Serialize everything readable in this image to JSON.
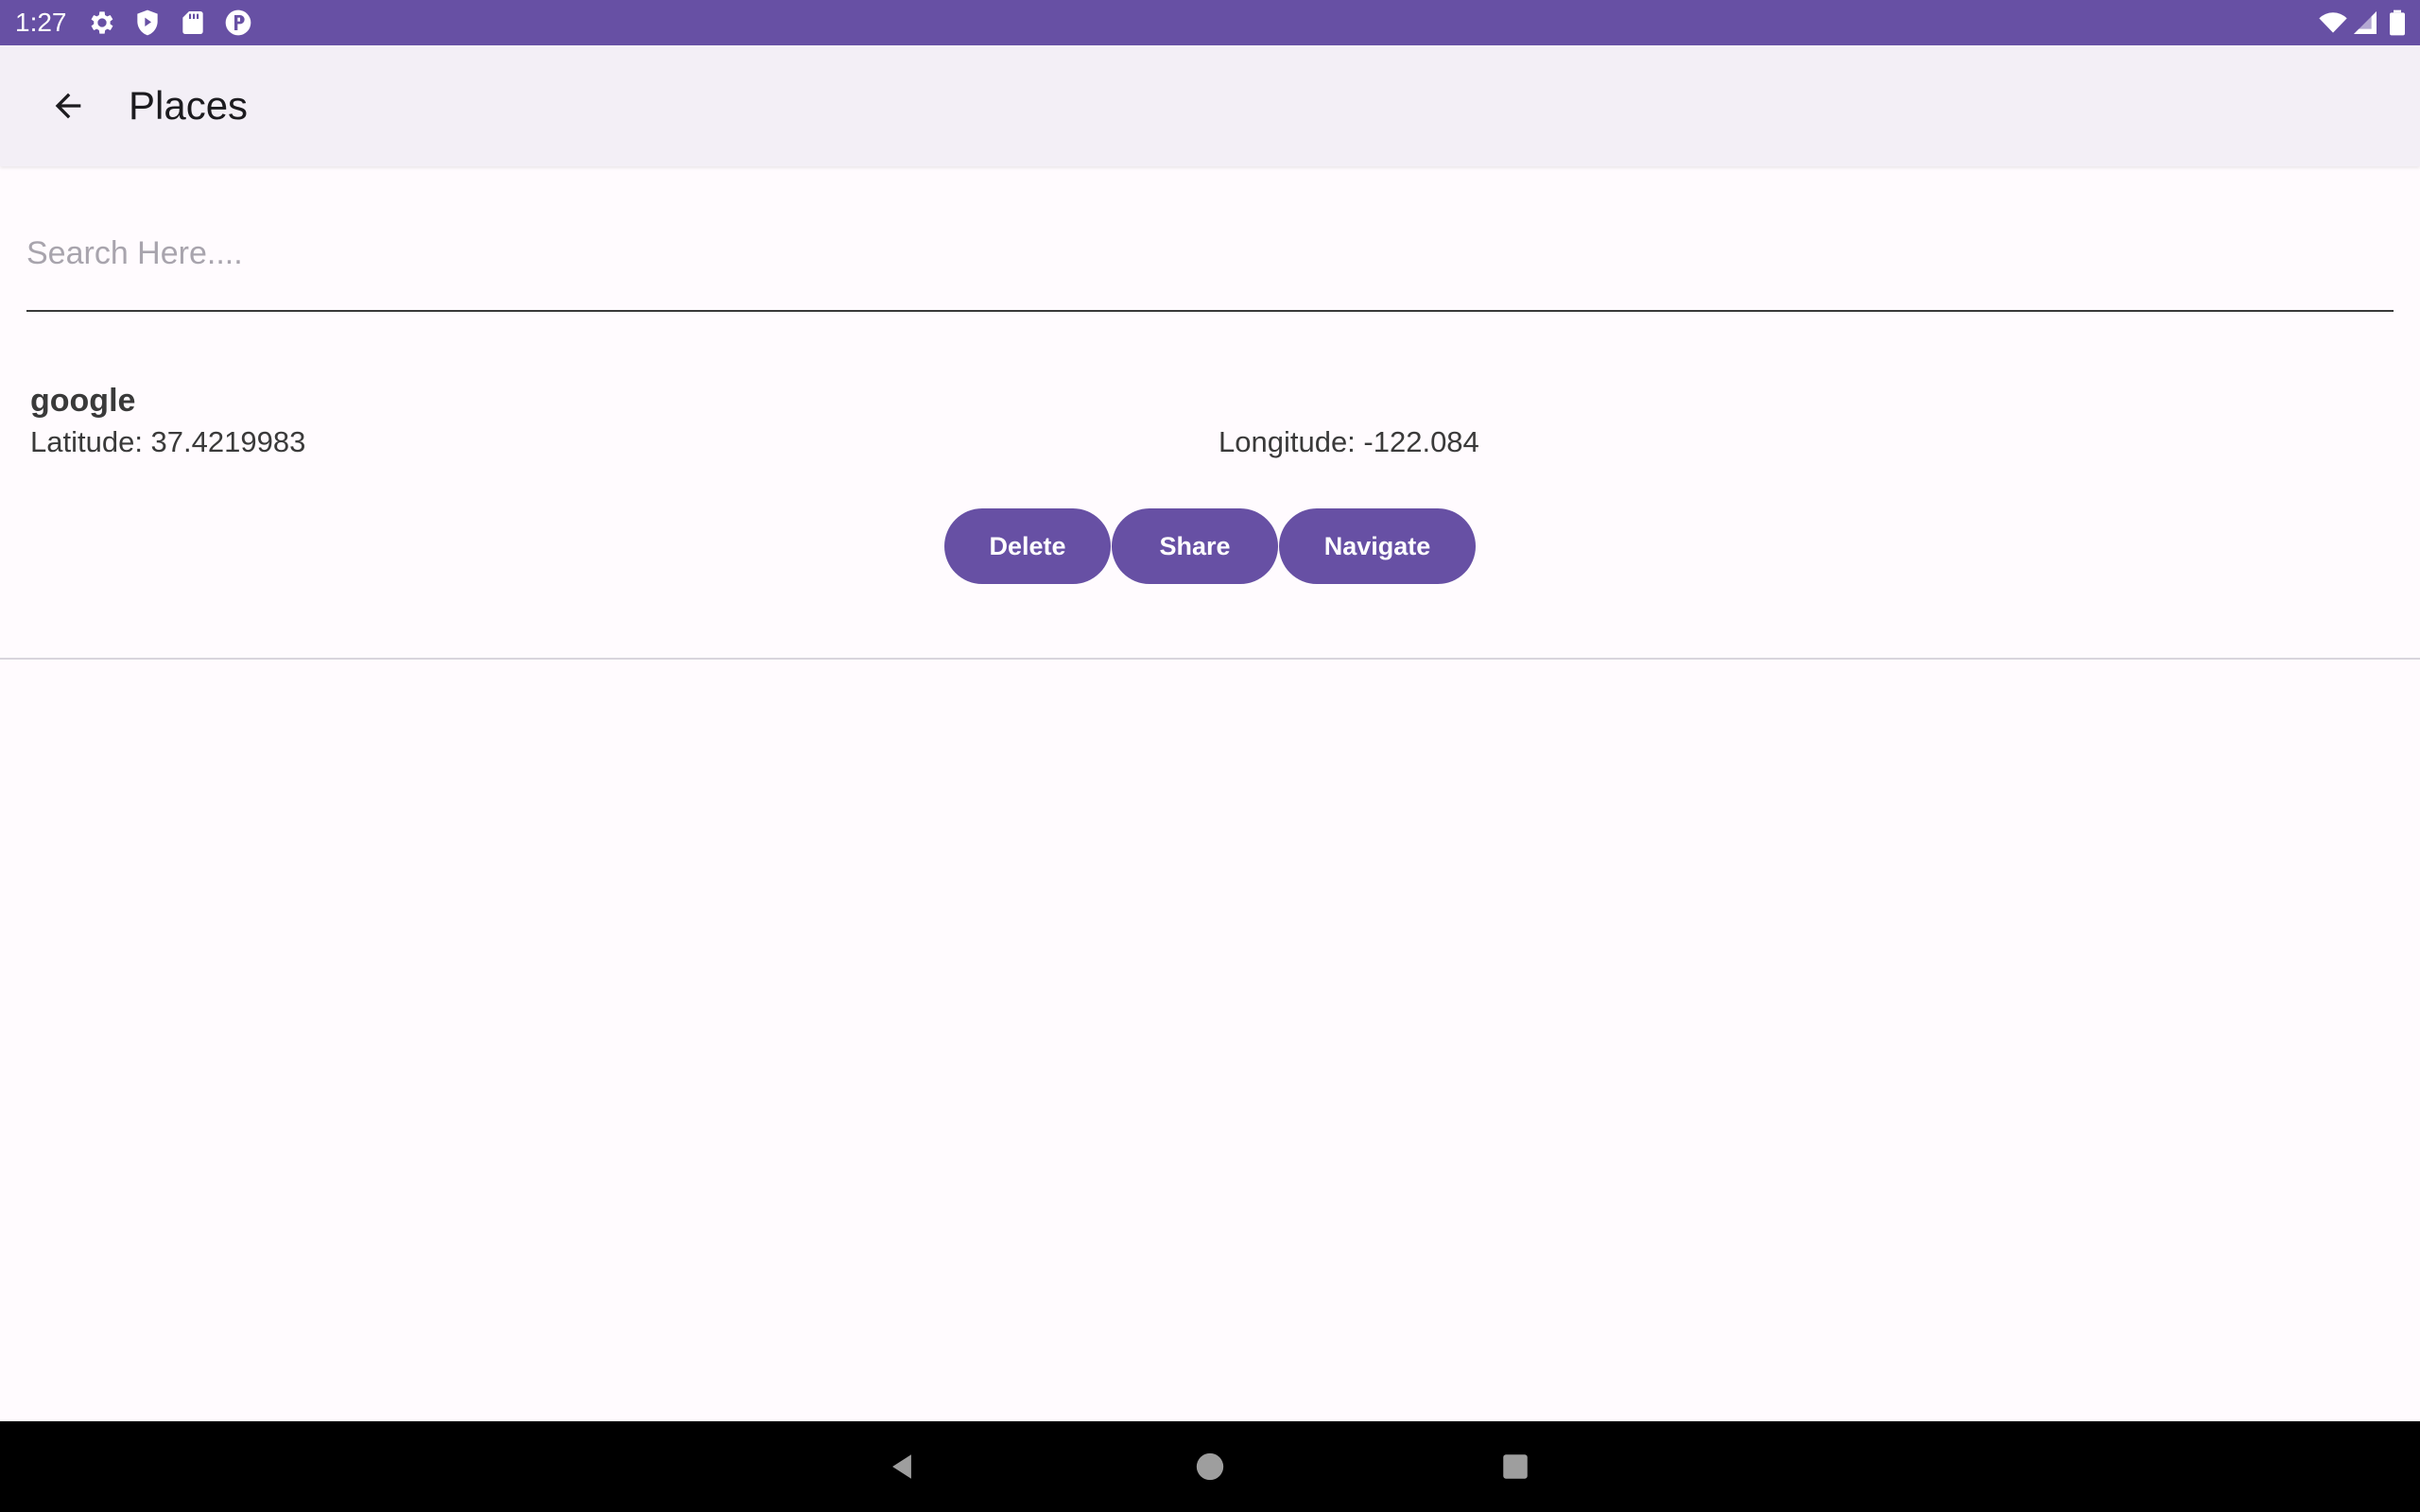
{
  "status_bar": {
    "time": "1:27",
    "background": "#6750a4",
    "left_icons": [
      "settings-icon",
      "shield-play-icon",
      "sd-card-icon",
      "p-badge-icon"
    ],
    "right_icons": [
      "wifi-icon",
      "cellular-signal-icon",
      "battery-icon"
    ]
  },
  "app_bar": {
    "title": "Places",
    "back_icon": "arrow-back-icon",
    "background": "#f3eff6"
  },
  "search": {
    "placeholder": "Search Here....",
    "value": ""
  },
  "places": [
    {
      "name": "google",
      "latitude_text": "Latitude: 37.4219983",
      "longitude_text": "Longitude: -122.084",
      "actions": {
        "delete_label": "Delete",
        "share_label": "Share",
        "navigate_label": "Navigate"
      }
    }
  ],
  "theme": {
    "accent": "#6750a4",
    "surface": "#fffbfe",
    "on_accent": "#ffffff"
  },
  "navigation_bar": {
    "buttons": [
      "nav-back-icon",
      "nav-home-icon",
      "nav-recents-icon"
    ]
  }
}
